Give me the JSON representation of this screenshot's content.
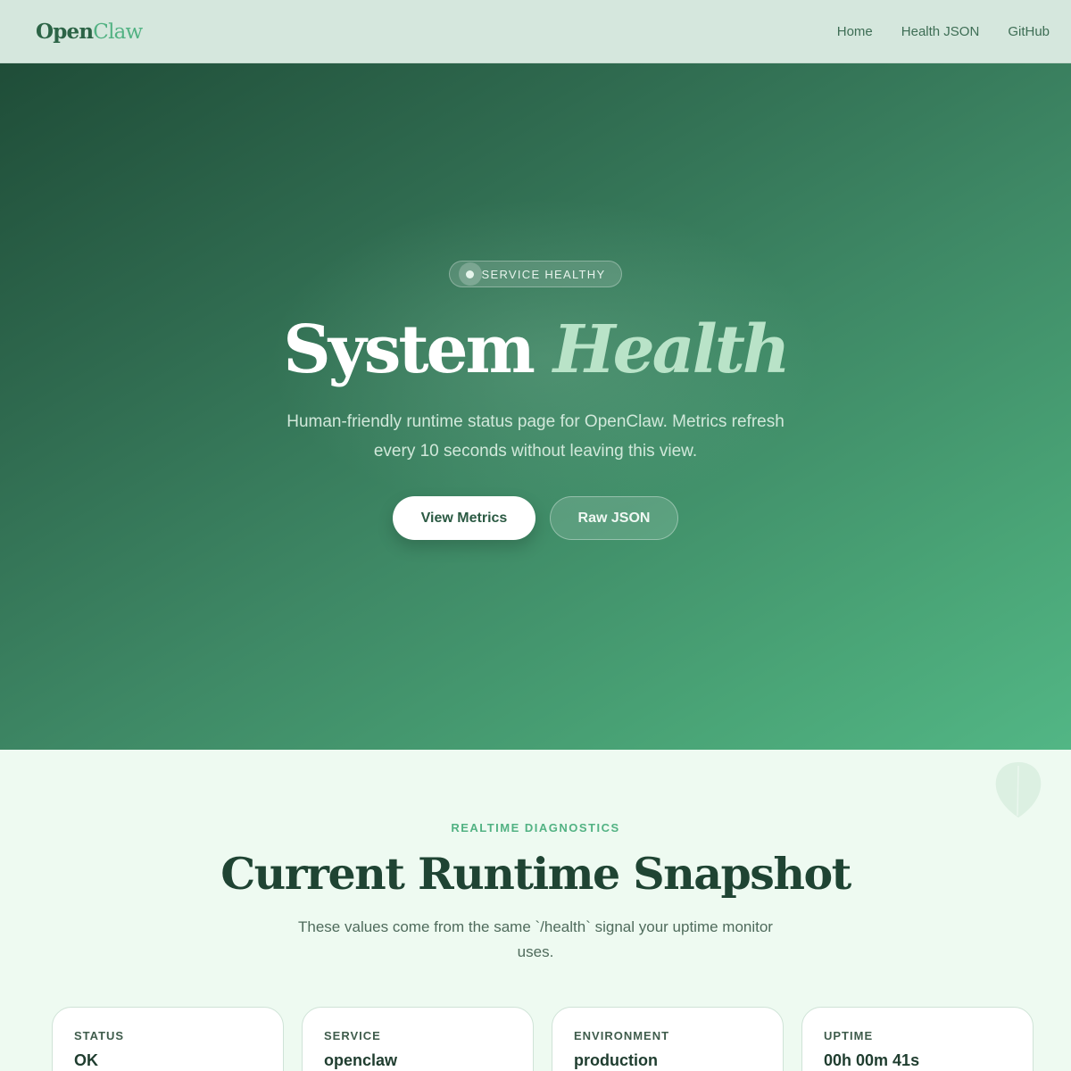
{
  "header": {
    "logo_part1": "Open",
    "logo_part2": "Claw",
    "nav": [
      "Home",
      "Health JSON",
      "GitHub"
    ]
  },
  "hero": {
    "badge": "SERVICE HEALTHY",
    "title_part1": "System",
    "title_part2": "Health",
    "subtitle": "Human-friendly runtime status page for OpenClaw. Metrics refresh every 10 seconds without leaving this view.",
    "primary_button": "View Metrics",
    "secondary_button": "Raw JSON"
  },
  "diagnostics": {
    "eyebrow": "REALTIME DIAGNOSTICS",
    "title": "Current Runtime Snapshot",
    "subtitle": "These values come from the same `/health` signal your uptime monitor uses.",
    "cards": [
      {
        "label": "STATUS",
        "value": "OK"
      },
      {
        "label": "SERVICE",
        "value": "openclaw"
      },
      {
        "label": "ENVIRONMENT",
        "value": "production"
      },
      {
        "label": "UPTIME",
        "value": "00h 00m 41s"
      }
    ]
  },
  "colors": {
    "brand_dark": "#2c6446",
    "brand_accent": "#52b283",
    "hero_gradient_start": "#1f4d38",
    "hero_gradient_end": "#52b685"
  },
  "icons": {
    "badge": "status-dot-icon",
    "decoration": "leaf-icon"
  }
}
